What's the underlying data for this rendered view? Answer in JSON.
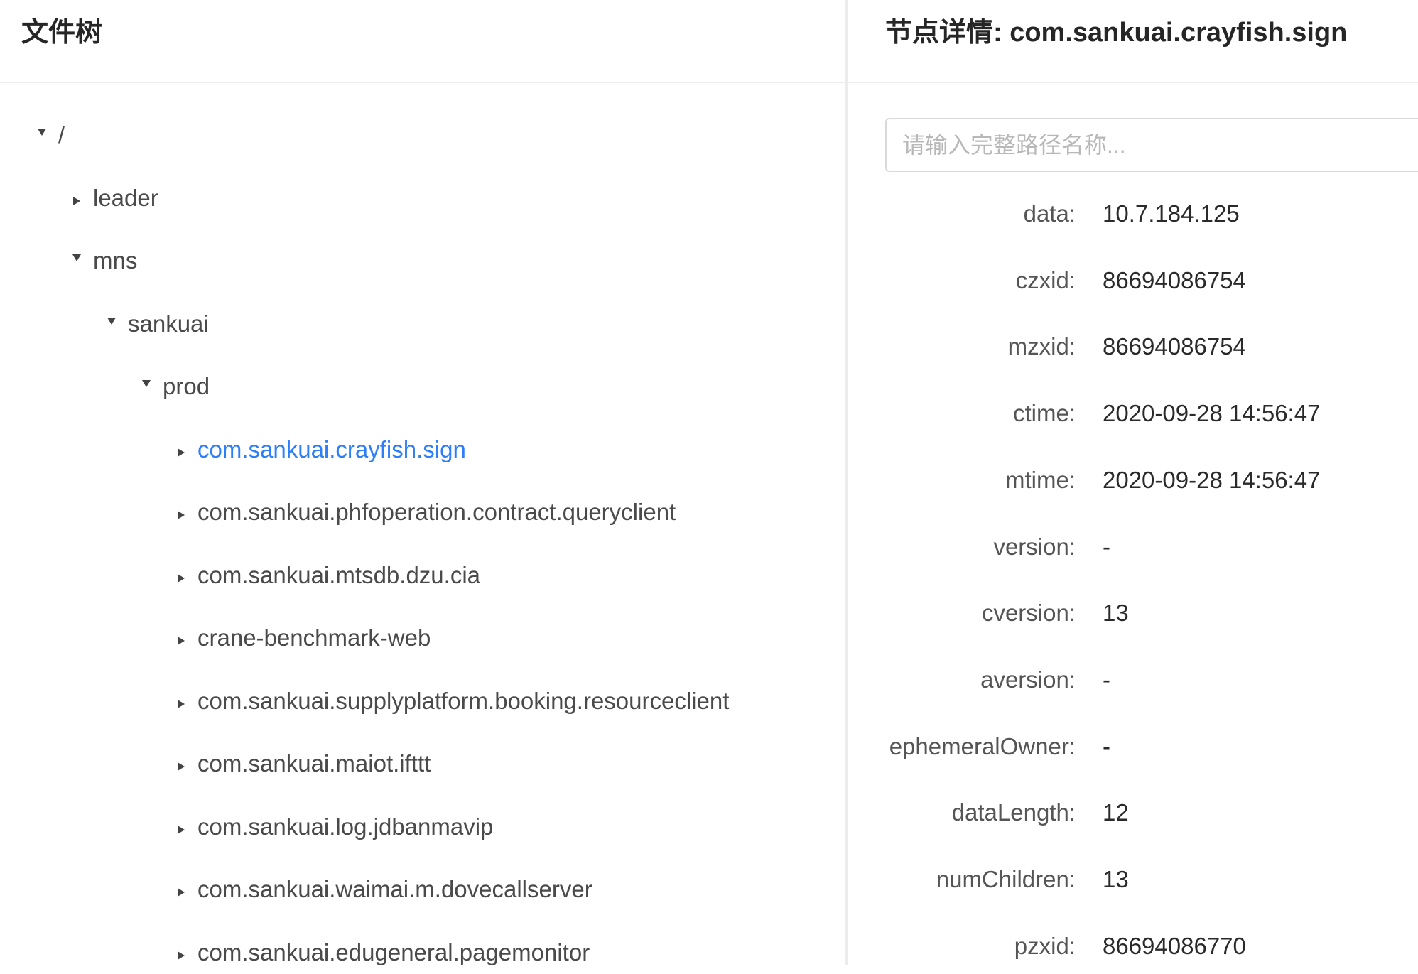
{
  "tree_panel": {
    "title": "文件树",
    "nodes": [
      {
        "label": "/",
        "expanded": true
      },
      {
        "label": "leader",
        "expanded": false
      },
      {
        "label": "mns",
        "expanded": true
      },
      {
        "label": "sankuai",
        "expanded": true
      },
      {
        "label": "prod",
        "expanded": true
      },
      {
        "label": "com.sankuai.crayfish.sign",
        "expanded": false,
        "selected": true
      },
      {
        "label": "com.sankuai.phfoperation.contract.queryclient",
        "expanded": false
      },
      {
        "label": "com.sankuai.mtsdb.dzu.cia",
        "expanded": false
      },
      {
        "label": "crane-benchmark-web",
        "expanded": false
      },
      {
        "label": "com.sankuai.supplyplatform.booking.resourceclient",
        "expanded": false
      },
      {
        "label": "com.sankuai.maiot.ifttt",
        "expanded": false
      },
      {
        "label": "com.sankuai.log.jdbanmavip",
        "expanded": false
      },
      {
        "label": "com.sankuai.waimai.m.dovecallserver",
        "expanded": false
      },
      {
        "label": "com.sankuai.edugeneral.pagemonitor",
        "expanded": false
      }
    ]
  },
  "detail_panel": {
    "title": "节点详情: com.sankuai.crayfish.sign",
    "search_placeholder": "请输入完整路径名称...",
    "fields": [
      {
        "label": "data:",
        "value": "10.7.184.125"
      },
      {
        "label": "czxid:",
        "value": "86694086754"
      },
      {
        "label": "mzxid:",
        "value": "86694086754"
      },
      {
        "label": "ctime:",
        "value": "2020-09-28 14:56:47"
      },
      {
        "label": "mtime:",
        "value": "2020-09-28 14:56:47"
      },
      {
        "label": "version:",
        "value": "-"
      },
      {
        "label": "cversion:",
        "value": "13"
      },
      {
        "label": "aversion:",
        "value": "-"
      },
      {
        "label": "ephemeralOwner:",
        "value": "-"
      },
      {
        "label": "dataLength:",
        "value": "12"
      },
      {
        "label": "numChildren:",
        "value": "13"
      },
      {
        "label": "pzxid:",
        "value": "86694086770"
      }
    ]
  },
  "colors": {
    "selected_link": "#2d7ff9",
    "divider": "#ececec"
  }
}
